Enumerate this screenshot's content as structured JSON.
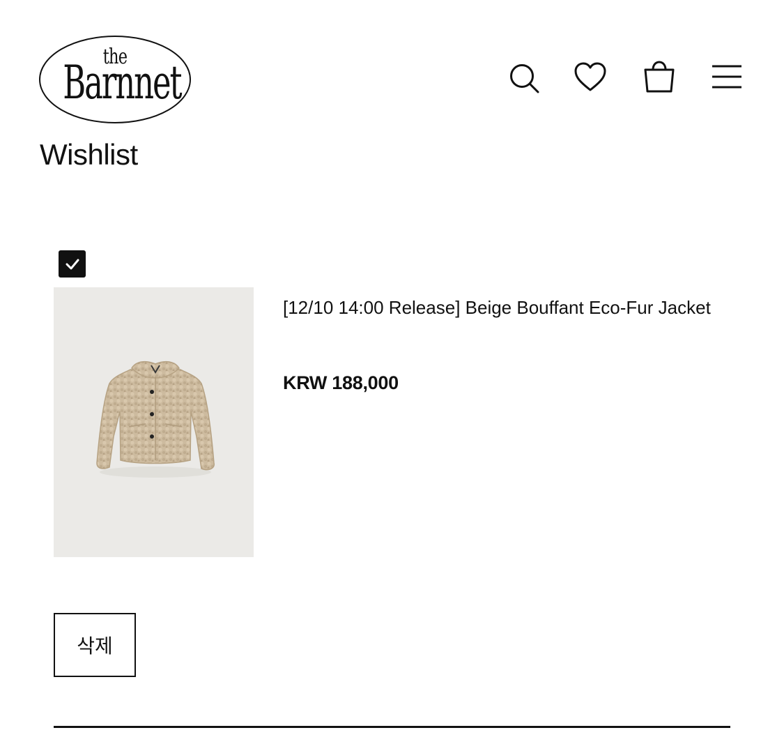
{
  "header": {
    "logo": {
      "top_word": "the",
      "brand_word": "Barnnet"
    },
    "icons": {
      "search": "search-icon",
      "wishlist": "heart-icon",
      "cart": "shopping-bag-icon",
      "menu": "hamburger-menu-icon"
    }
  },
  "page": {
    "title": "Wishlist"
  },
  "wishlist": {
    "items": [
      {
        "selected": true,
        "image": "beige-fur-jacket",
        "name": "[12/10 14:00 Release] Beige Bouffant Eco-Fur Jacket",
        "price": "KRW 188,000"
      }
    ],
    "delete_label": "삭제"
  },
  "colors": {
    "text": "#111111",
    "background": "#ffffff",
    "image_background": "#ebeae7",
    "product": "#cbb89c"
  }
}
